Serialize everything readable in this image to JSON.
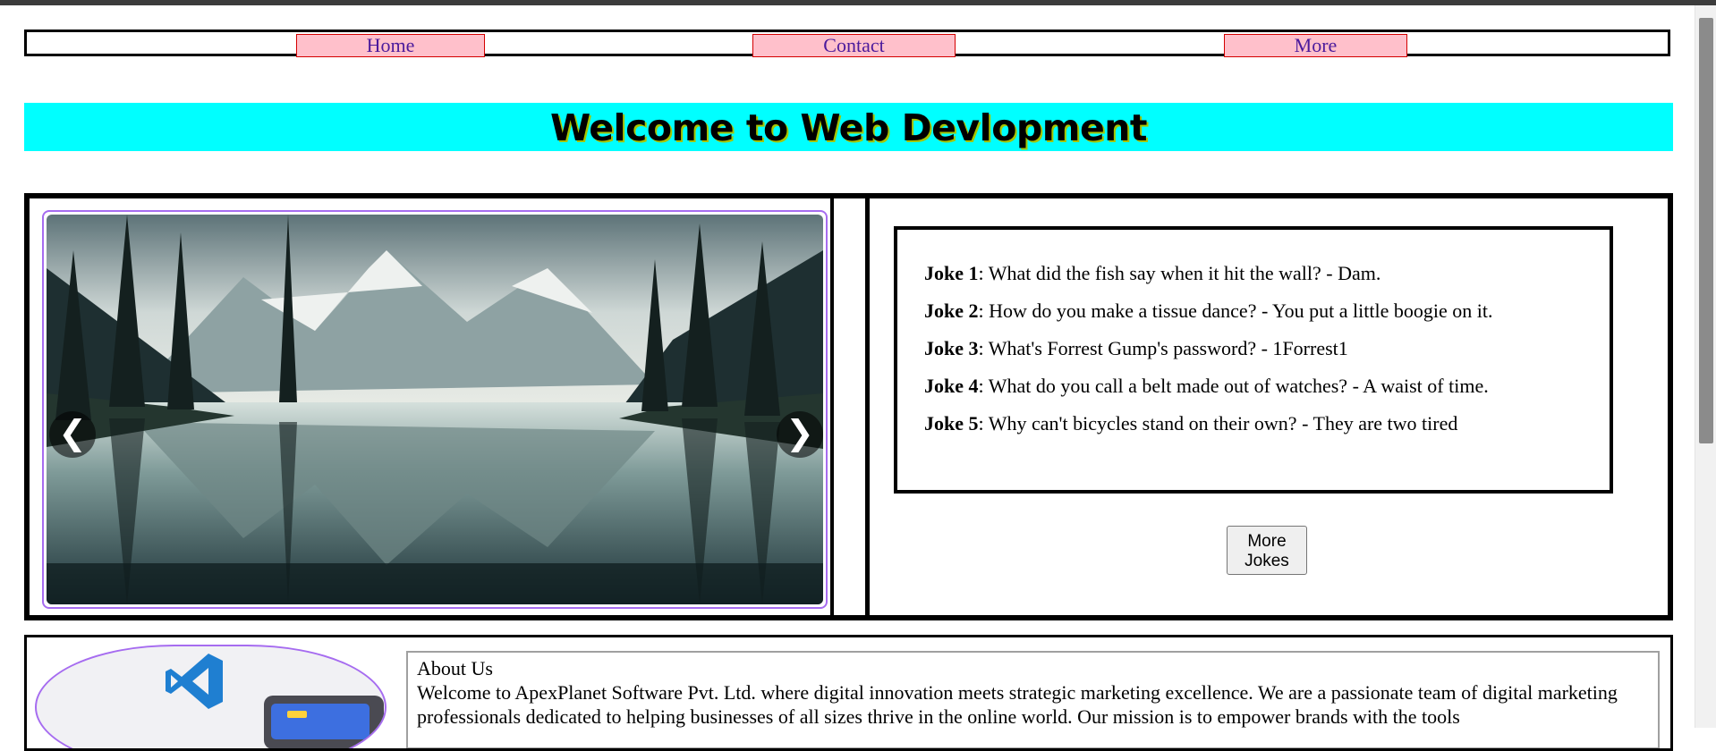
{
  "nav": {
    "items": [
      {
        "label": "Home"
      },
      {
        "label": "Contact"
      },
      {
        "label": "More"
      }
    ]
  },
  "banner": {
    "title": "Welcome to Web Devlopment"
  },
  "carousel": {
    "prev_glyph": "❮",
    "next_glyph": "❯",
    "image": "mountain-lake-landscape"
  },
  "jokes": [
    {
      "label": "Joke 1",
      "text": ": What did the fish say when it hit the wall? - Dam."
    },
    {
      "label": "Joke 2",
      "text": ": How do you make a tissue dance? - You put a little boogie on it."
    },
    {
      "label": "Joke 3",
      "text": ": What's Forrest Gump's password? - 1Forrest1"
    },
    {
      "label": "Joke 4",
      "text": ": What do you call a belt made out of watches? - A waist of time."
    },
    {
      "label": "Joke 5",
      "text": ": Why can't bicycles stand on their own? - They are two tired"
    }
  ],
  "more_jokes_button": {
    "line1": "More",
    "line2": "Jokes"
  },
  "about": {
    "title": "About Us",
    "text": "Welcome to ApexPlanet Software Pvt. Ltd. where digital innovation meets strategic marketing excellence. We are a passionate team of digital marketing professionals dedicated to helping businesses of all sizes thrive in the online world. Our mission is to empower brands with the tools"
  },
  "logo": {
    "icon": "vscode-icon"
  },
  "colors": {
    "nav_bg": "#ffc0cb",
    "nav_border": "#d40000",
    "nav_text": "#4b1a9c",
    "banner_bg": "#00ffff",
    "accent_border": "#a66cf0"
  }
}
